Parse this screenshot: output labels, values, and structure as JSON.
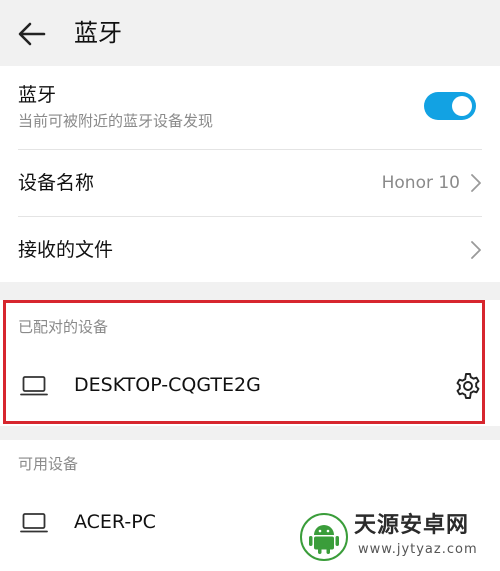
{
  "header": {
    "title": "蓝牙"
  },
  "bluetooth": {
    "label": "蓝牙",
    "description": "当前可被附近的蓝牙设备发现",
    "enabled": true,
    "accent_color": "#12a2e3"
  },
  "device_name": {
    "label": "设备名称",
    "value": "Honor 10"
  },
  "received_files": {
    "label": "接收的文件"
  },
  "paired_section": {
    "header": "已配对的设备",
    "devices": [
      {
        "name": "DESKTOP-CQGTE2G",
        "icon": "laptop-icon",
        "action_icon": "gear-icon"
      }
    ],
    "highlight_color": "#d7262e"
  },
  "available_section": {
    "header": "可用设备",
    "devices": [
      {
        "name": "ACER-PC",
        "icon": "laptop-icon"
      }
    ]
  },
  "watermark": {
    "title": "天源安卓网",
    "url": "www.jytyaz.com"
  }
}
